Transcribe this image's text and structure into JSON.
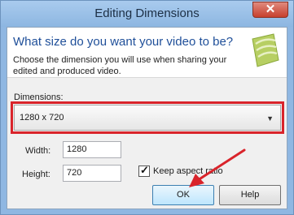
{
  "window": {
    "title": "Editing Dimensions",
    "close_glyph": "✕"
  },
  "header": {
    "question": "What size do you want your video to be?",
    "description": "Choose the dimension you will use when sharing your edited and produced video."
  },
  "dimensions": {
    "label": "Dimensions:",
    "selected": "1280 x 720",
    "highlight_color": "#d9242b"
  },
  "width": {
    "label": "Width:",
    "value": "1280"
  },
  "height": {
    "label": "Height:",
    "value": "720"
  },
  "aspect": {
    "label": "Keep aspect ratio",
    "checked": true,
    "check_glyph": "✓"
  },
  "buttons": {
    "ok": "OK",
    "help": "Help"
  },
  "icons": [
    "close-icon",
    "app-logo-icon",
    "dropdown-arrow-icon",
    "checkbox-check-icon",
    "pointer-arrow-icon"
  ]
}
